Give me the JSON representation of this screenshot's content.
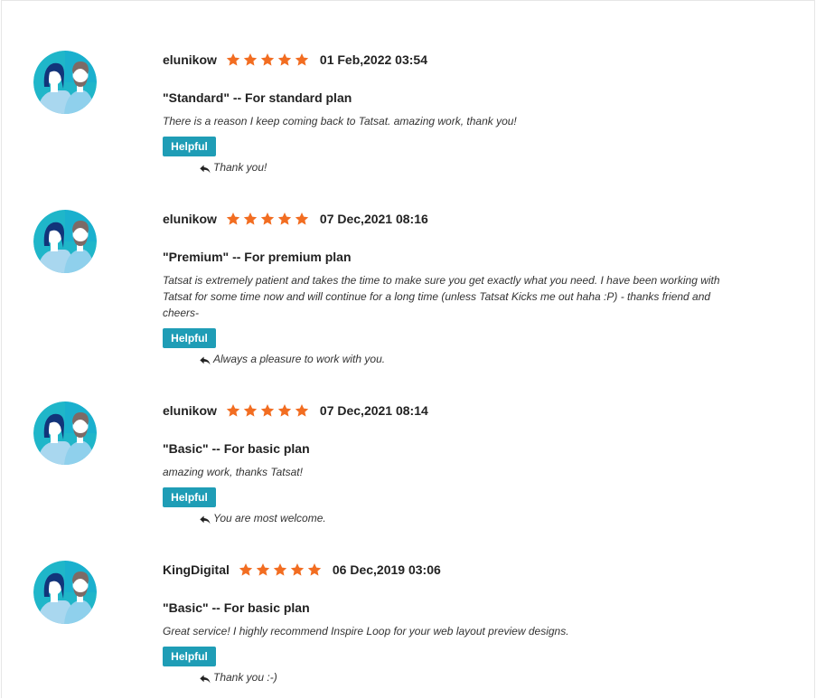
{
  "colors": {
    "star": "#f26d21",
    "helpful_bg": "#1f9db6",
    "avatar_bg": "#1fb6c9"
  },
  "icons": {
    "star": "star-icon",
    "reply": "reply-icon",
    "avatar": "couple-avatar"
  },
  "reviews": [
    {
      "user": "elunikow",
      "rating": 5,
      "date": "01 Feb,2022 03:54",
      "title": "\"Standard\" -- For standard plan",
      "body": "There is a reason I keep coming back to Tatsat. amazing work, thank you!",
      "helpful_label": "Helpful",
      "reply": "Thank you!"
    },
    {
      "user": "elunikow",
      "rating": 5,
      "date": "07 Dec,2021 08:16",
      "title": "\"Premium\" -- For premium plan",
      "body": "Tatsat is extremely patient and takes the time to make sure you get exactly what you need. I have been working with Tatsat for some time now and will continue for a long time (unless Tatsat Kicks me out haha :P) - thanks friend and cheers-",
      "helpful_label": "Helpful",
      "reply": "Always a pleasure to work with you."
    },
    {
      "user": "elunikow",
      "rating": 5,
      "date": "07 Dec,2021 08:14",
      "title": "\"Basic\" -- For basic plan",
      "body": "amazing work, thanks Tatsat!",
      "helpful_label": "Helpful",
      "reply": "You are most welcome."
    },
    {
      "user": "KingDigital",
      "rating": 5,
      "date": "06 Dec,2019 03:06",
      "title": "\"Basic\" -- For basic plan",
      "body": "Great service! I highly recommend Inspire Loop for your web layout preview designs.",
      "helpful_label": "Helpful",
      "reply": "Thank you :-)"
    }
  ]
}
